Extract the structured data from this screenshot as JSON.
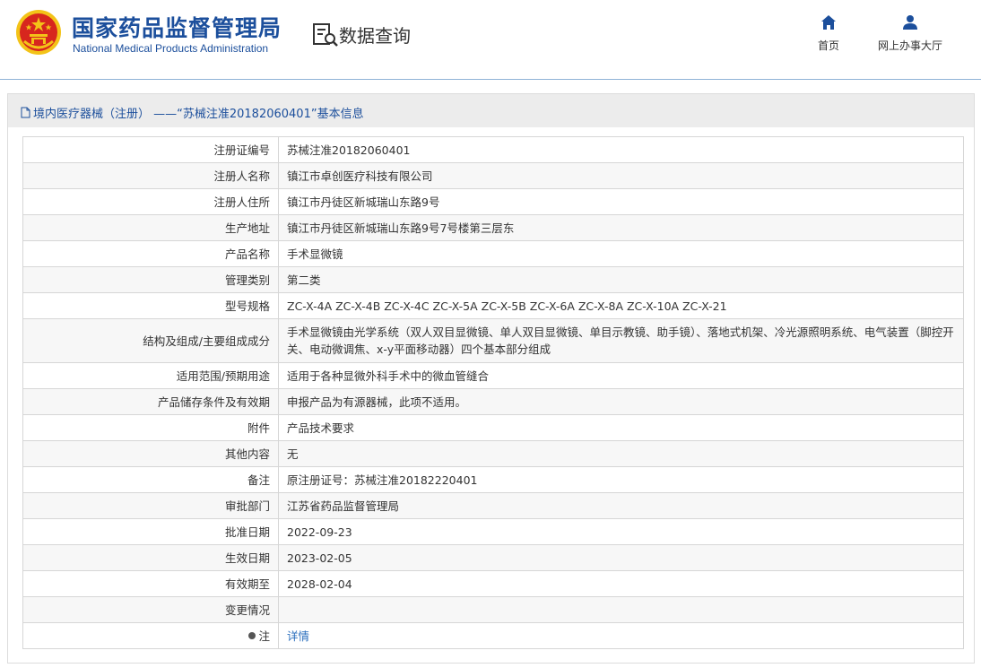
{
  "header": {
    "logo_cn": "国家药品监督管理局",
    "logo_en": "National Medical Products Administration",
    "section_title": "数据查询",
    "nav": [
      {
        "label": "首页",
        "icon": "home-icon"
      },
      {
        "label": "网上办事大厅",
        "icon": "user-icon"
      }
    ]
  },
  "panel": {
    "title": "境内医疗器械（注册） ——“苏械注准20182060401”基本信息"
  },
  "colors": {
    "brand_blue": "#1c4f9c",
    "link_blue": "#2a6ebd",
    "emblem_red": "#d7261e",
    "emblem_gold": "#f3c318"
  },
  "rows": [
    {
      "label": "注册证编号",
      "value": "苏械注准20182060401"
    },
    {
      "label": "注册人名称",
      "value": "镇江市卓创医疗科技有限公司"
    },
    {
      "label": "注册人住所",
      "value": "镇江市丹徒区新城瑞山东路9号"
    },
    {
      "label": "生产地址",
      "value": "镇江市丹徒区新城瑞山东路9号7号楼第三层东"
    },
    {
      "label": "产品名称",
      "value": "手术显微镜"
    },
    {
      "label": "管理类别",
      "value": "第二类"
    },
    {
      "label": "型号规格",
      "value": "ZC-X-4A ZC-X-4B ZC-X-4C ZC-X-5A ZC-X-5B ZC-X-6A ZC-X-8A ZC-X-10A ZC-X-21"
    },
    {
      "label": "结构及组成/主要组成成分",
      "value": "手术显微镜由光学系统（双人双目显微镜、单人双目显微镜、单目示教镜、助手镜）、落地式机架、冷光源照明系统、电气装置（脚控开关、电动微调焦、x-y平面移动器）四个基本部分组成"
    },
    {
      "label": "适用范围/预期用途",
      "value": "适用于各种显微外科手术中的微血管缝合"
    },
    {
      "label": "产品储存条件及有效期",
      "value": "申报产品为有源器械，此项不适用。"
    },
    {
      "label": "附件",
      "value": "产品技术要求"
    },
    {
      "label": "其他内容",
      "value": "无"
    },
    {
      "label": "备注",
      "value": "原注册证号：苏械注准20182220401"
    },
    {
      "label": "审批部门",
      "value": "江苏省药品监督管理局"
    },
    {
      "label": "批准日期",
      "value": "2022-09-23"
    },
    {
      "label": "生效日期",
      "value": "2023-02-05"
    },
    {
      "label": "有效期至",
      "value": "2028-02-04"
    },
    {
      "label": "变更情况",
      "value": ""
    },
    {
      "label": "注",
      "value": "详情"
    }
  ]
}
